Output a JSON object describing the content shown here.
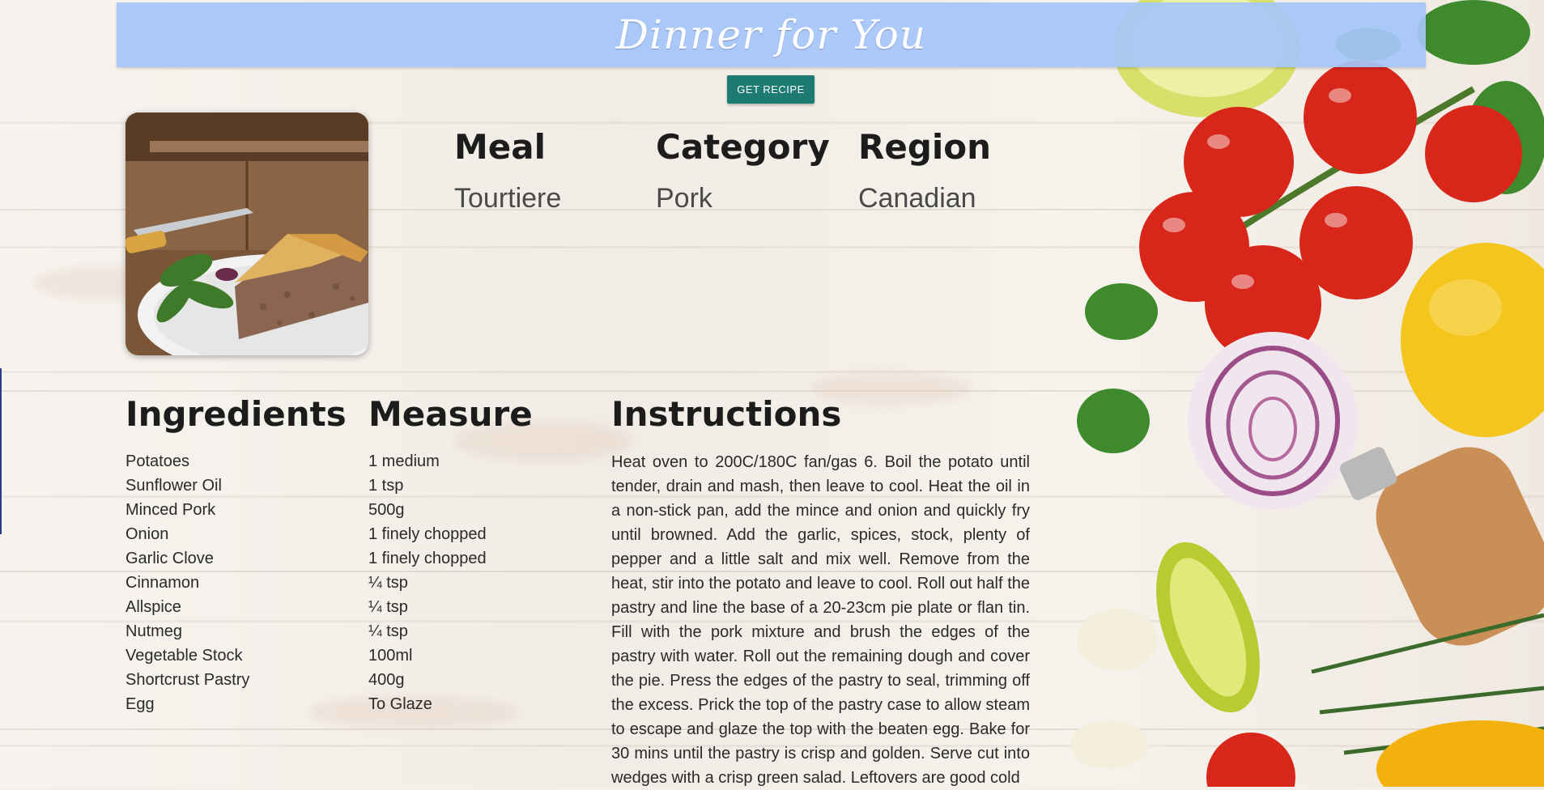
{
  "header": {
    "title": "Dinner for You"
  },
  "actions": {
    "get_recipe_label": "GET RECIPE"
  },
  "meal_info": {
    "meal_label": "Meal",
    "meal_value": "Tourtiere",
    "category_label": "Category",
    "category_value": "Pork",
    "region_label": "Region",
    "region_value": "Canadian"
  },
  "sections": {
    "ingredients": "Ingredients",
    "measure": "Measure",
    "instructions": "Instructions"
  },
  "ingredients": [
    {
      "name": "Potatoes",
      "measure": "1 medium"
    },
    {
      "name": "Sunflower Oil",
      "measure": "1 tsp"
    },
    {
      "name": "Minced Pork",
      "measure": "500g"
    },
    {
      "name": "Onion",
      "measure": "1 finely chopped"
    },
    {
      "name": "Garlic Clove",
      "measure": "1 finely chopped"
    },
    {
      "name": "Cinnamon",
      "measure": "¼ tsp"
    },
    {
      "name": "Allspice",
      "measure": "¼ tsp"
    },
    {
      "name": "Nutmeg",
      "measure": "¼ tsp"
    },
    {
      "name": "Vegetable Stock",
      "measure": "100ml"
    },
    {
      "name": "Shortcrust Pastry",
      "measure": "400g"
    },
    {
      "name": "Egg",
      "measure": "To Glaze"
    }
  ],
  "instructions_text": "Heat oven to 200C/180C fan/gas 6. Boil the potato until tender, drain and mash, then leave to cool. Heat the oil in a non-stick pan, add the mince and onion and quickly fry until browned. Add the garlic, spices, stock, plenty of pepper and a little salt and mix well. Remove from the heat, stir into the potato and leave to cool. Roll out half the pastry and line the base of a 20-23cm pie plate or flan tin. Fill with the pork mixture and brush the edges of the pastry with water. Roll out the remaining dough and cover the pie. Press the edges of the pastry to seal, trimming off the excess. Prick the top of the pastry case to allow steam to escape and glaze the top with the beaten egg. Bake for 30 mins until the pastry is crisp and golden. Serve cut into wedges with a crisp green salad. Leftovers are good cold",
  "colors": {
    "header_bg": "#a5c5fa",
    "button_bg": "#1e7b71",
    "heading_text": "#1c1c1c",
    "body_text": "#2a2a2a"
  }
}
